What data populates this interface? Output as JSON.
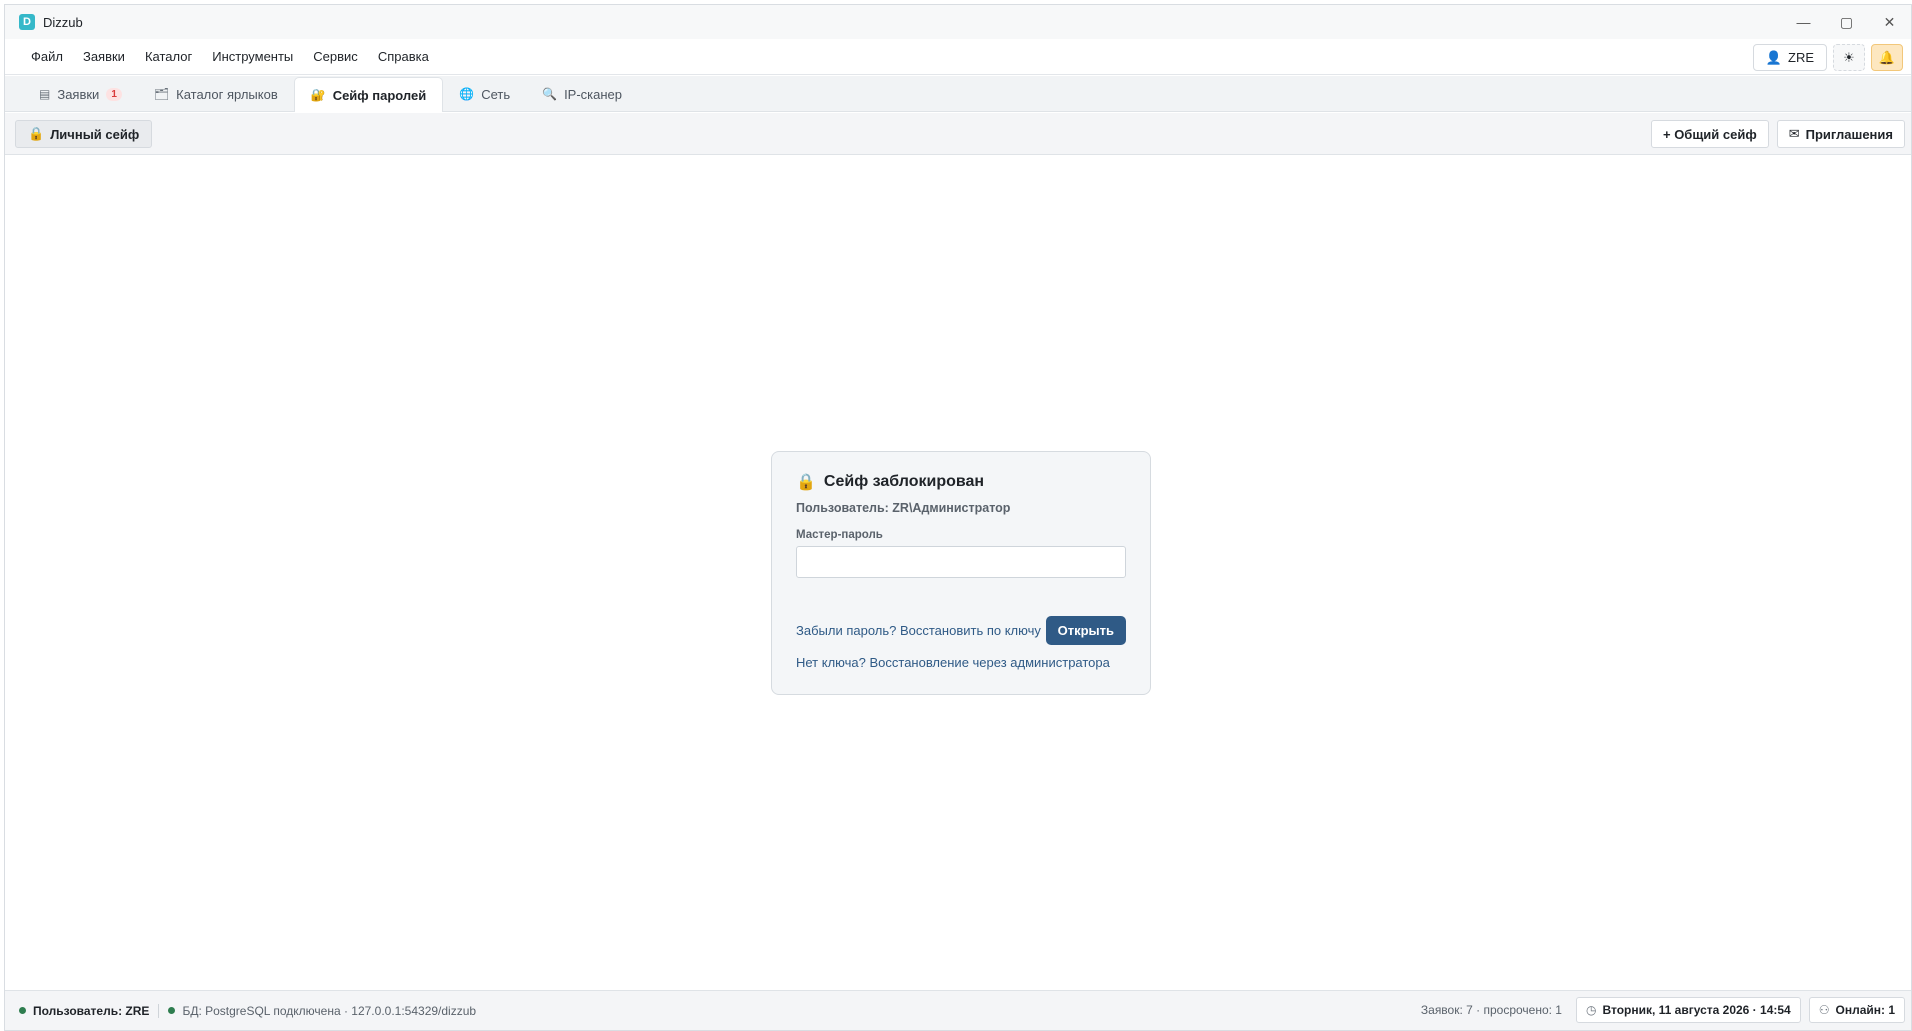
{
  "app": {
    "logo_letter": "D",
    "title": "Dizzub"
  },
  "window_controls": {
    "minimize": "—",
    "maximize": "▢",
    "close": "✕"
  },
  "menu": {
    "items": [
      "Файл",
      "Заявки",
      "Каталог",
      "Инструменты",
      "Сервис",
      "Справка"
    ],
    "user_label": "ZRE",
    "user_icon": "person-icon",
    "theme_icon": "sun-icon",
    "bell_icon": "bell-icon"
  },
  "tabs": [
    {
      "label": "Заявки",
      "icon": "clipboard-icon",
      "badge": "1",
      "active": false
    },
    {
      "label": "Каталог ярлыков",
      "icon": "folder-icon",
      "active": false
    },
    {
      "label": "Сейф паролей",
      "icon": "safe-icon",
      "active": true
    },
    {
      "label": "Сеть",
      "icon": "globe-icon",
      "active": false
    },
    {
      "label": "IP-сканер",
      "icon": "magnifier-icon",
      "active": false
    }
  ],
  "toolbar": {
    "personal_vault_label": "Личный сейф",
    "shared_vault_label": "+ Общий сейф",
    "invitations_label": "Приглашения"
  },
  "lock": {
    "title": "Сейф заблокирован",
    "user_line": "Пользователь: ZR\\Администратор",
    "field_label": "Мастер-пароль",
    "field_value": "",
    "forgot_link": "Забыли пароль? Восстановить по ключу",
    "open_button": "Открыть",
    "no_key_link": "Нет ключа? Восстановление через администратора"
  },
  "status": {
    "user": "Пользователь: ZRE",
    "db": "БД: PostgreSQL подключена · 127.0.0.1:54329/dizzub",
    "requests": "Заявок: 7 · просрочено: 1",
    "datetime": "Вторник, 11 августа 2026 · 14:54",
    "online": "Онлайн: 1",
    "status_color": "#2e7d4f"
  },
  "colors": {
    "accent": "#2f5a86",
    "badge_red": "#d93a3a",
    "logo": "#35b8c9"
  }
}
